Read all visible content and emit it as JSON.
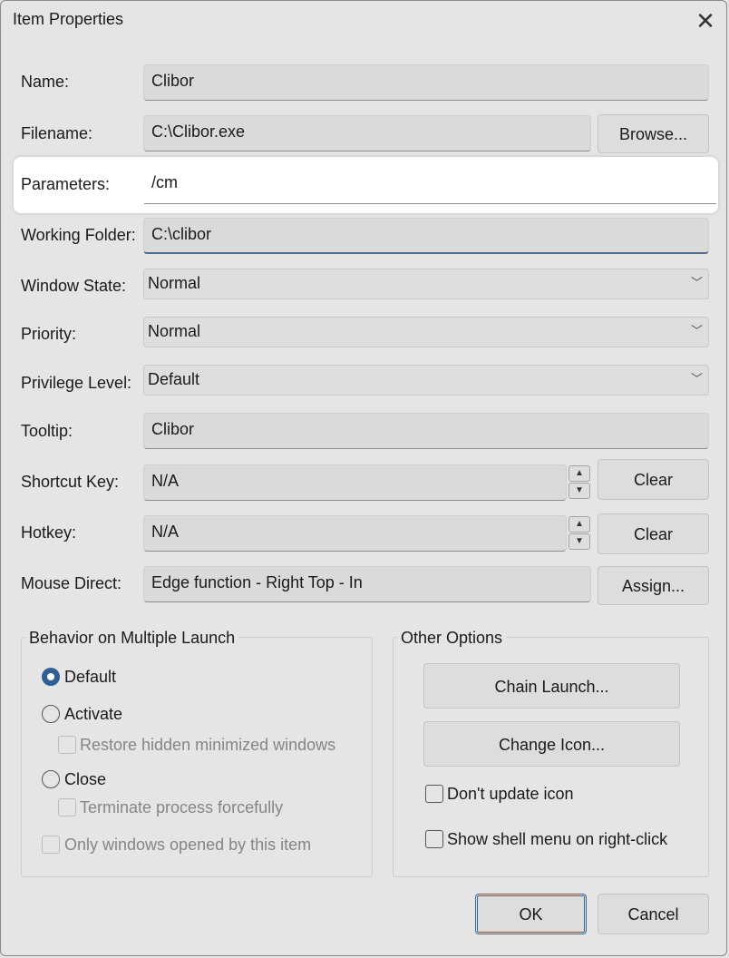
{
  "window": {
    "title": "Item Properties"
  },
  "fields": {
    "name": {
      "label": "Name:",
      "value": "Clibor"
    },
    "filename": {
      "label": "Filename:",
      "value": "C:\\Clibor.exe"
    },
    "parameters": {
      "label": "Parameters:",
      "value": "/cm"
    },
    "working_folder": {
      "label": "Working Folder:",
      "value": "C:\\clibor"
    },
    "window_state": {
      "label": "Window State:",
      "value": "Normal"
    },
    "priority": {
      "label": "Priority:",
      "value": "Normal"
    },
    "privilege_level": {
      "label": "Privilege Level:",
      "value": "Default"
    },
    "tooltip": {
      "label": "Tooltip:",
      "value": "Clibor"
    },
    "shortcut_key": {
      "label": "Shortcut Key:",
      "value": "N/A"
    },
    "hotkey": {
      "label": "Hotkey:",
      "value": "N/A"
    },
    "mouse_direct": {
      "label": "Mouse Direct:",
      "value": "Edge function - Right Top - In"
    }
  },
  "buttons": {
    "browse": "Browse...",
    "clear_shortcut": "Clear",
    "clear_hotkey": "Clear",
    "assign": "Assign...",
    "chain_launch": "Chain Launch...",
    "change_icon": "Change Icon...",
    "ok": "OK",
    "cancel": "Cancel"
  },
  "behavior_group": {
    "title": "Behavior on Multiple Launch",
    "options": {
      "default": "Default",
      "activate": "Activate",
      "restore_hidden": "Restore hidden minimized windows",
      "close": "Close",
      "terminate": "Terminate process forcefully",
      "only_windows": "Only windows opened by this item"
    },
    "selected": "Default"
  },
  "other_group": {
    "title": "Other Options",
    "dont_update_icon": "Don't update icon",
    "show_shell_menu": "Show shell menu on right-click"
  },
  "colors": {
    "accent": "#2f5f93",
    "background": "#e5e5e5",
    "highlight": "#ffffff"
  }
}
